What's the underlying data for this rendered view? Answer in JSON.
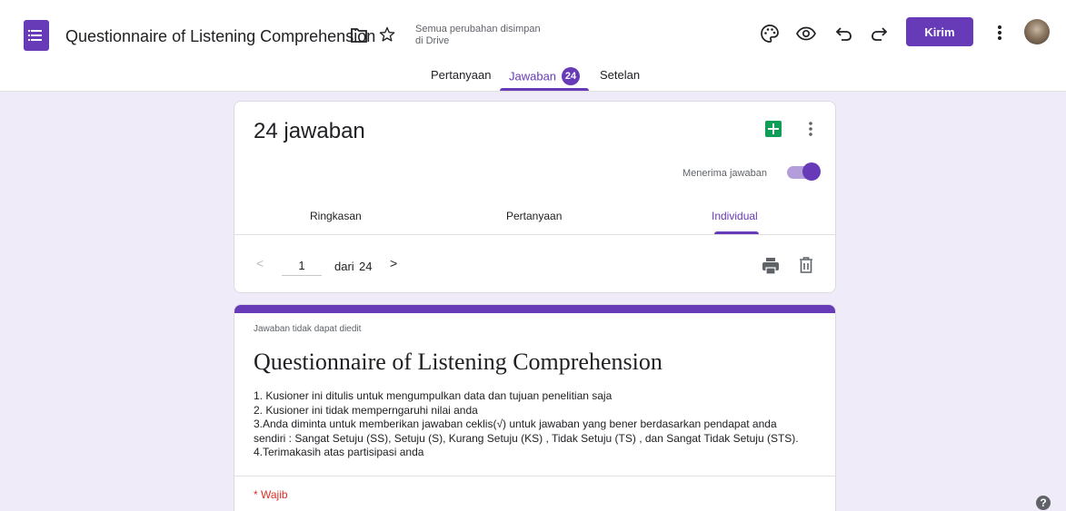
{
  "header": {
    "doc_title": "Questionnaire of Listening Comprehension",
    "save_status_line1": "Semua perubahan disimpan",
    "save_status_line2": "di Drive",
    "send_label": "Kirim",
    "icons": [
      "forms-app-icon",
      "folder-icon",
      "star-icon",
      "palette-icon",
      "preview-eye-icon",
      "undo-icon",
      "redo-icon",
      "more-vert-icon",
      "avatar"
    ]
  },
  "tabs": [
    {
      "label": "Pertanyaan"
    },
    {
      "label": "Jawaban",
      "badge": "24",
      "active": true
    },
    {
      "label": "Setelan"
    }
  ],
  "responses": {
    "count_title": "24 jawaban",
    "accepting_label": "Menerima jawaban",
    "accepting": true,
    "subtabs": [
      {
        "label": "Ringkasan"
      },
      {
        "label": "Pertanyaan"
      },
      {
        "label": "Individual",
        "active": true
      }
    ],
    "pager": {
      "prev": "<",
      "current": "1",
      "of": "dari",
      "total": "24",
      "next": ">"
    }
  },
  "form": {
    "not_editable": "Jawaban tidak dapat diedit",
    "title": "Questionnaire of Listening Comprehension",
    "description": [
      "1. Kusioner ini ditulis untuk mengumpulkan data dan tujuan penelitian saja",
      "2. Kusioner ini tidak memperngaruhi nilai anda",
      "3.Anda diminta untuk memberikan jawaban ceklis(√) untuk jawaban yang bener berdasarkan pendapat anda",
      "sendiri : Sangat Setuju (SS), Setuju (S), Kurang Setuju (KS) , Tidak Setuju (TS) , dan Sangat Tidak Setuju (STS).",
      "4.Terimakasih atas partisipasi anda"
    ],
    "required_note": "* Wajib"
  },
  "help": "?",
  "colors": {
    "accent": "#673ab7",
    "background": "#f0ebf8",
    "sheets": "#0f9d58",
    "required": "#d93025"
  }
}
